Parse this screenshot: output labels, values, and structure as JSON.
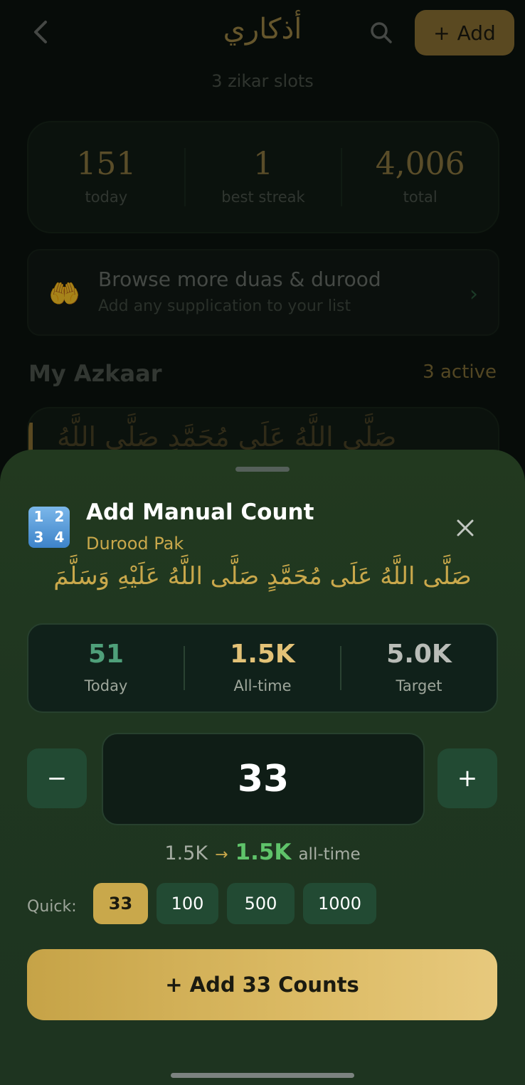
{
  "header": {
    "title": "أذكاري",
    "add_label": "Add",
    "add_plus": "+"
  },
  "slots_text": "3 zikar slots",
  "stats": [
    {
      "value": "151",
      "label": "today"
    },
    {
      "value": "1",
      "label": "best streak"
    },
    {
      "value": "4,006",
      "label": "total"
    }
  ],
  "browse": {
    "title": "Browse more duas & durood",
    "subtitle": "Add any supplication to your list",
    "icon": "🤲"
  },
  "section": {
    "title": "My Azkaar",
    "count": "3 active"
  },
  "peek_text": "صَلَّى اللَّهُ عَلَى مُحَمَّدٍ صَلَّى اللَّهُ",
  "sheet": {
    "title": "Add Manual Count",
    "subtitle": "Durood Pak",
    "arabic": "صَلَّى اللَّهُ عَلَى مُحَمَّدٍ صَلَّى اللَّهُ عَلَيْهِ وَسَلَّمَ",
    "mini_stats": [
      {
        "value": "51",
        "label": "Today",
        "color": "#4fa07a"
      },
      {
        "value": "1.5K",
        "label": "All-time",
        "color": "#e3c277"
      },
      {
        "value": "5.0K",
        "label": "Target",
        "color": "#b9bcb7"
      }
    ],
    "count": "33",
    "minus": "−",
    "plus": "+",
    "preview": {
      "from": "1.5K",
      "arrow": "→",
      "to": "1.5K",
      "suffix": "all-time"
    },
    "quick_label": "Quick:",
    "quick": [
      "33",
      "100",
      "500",
      "1000"
    ],
    "quick_selected": "33",
    "cta": "+ Add 33 Counts"
  }
}
